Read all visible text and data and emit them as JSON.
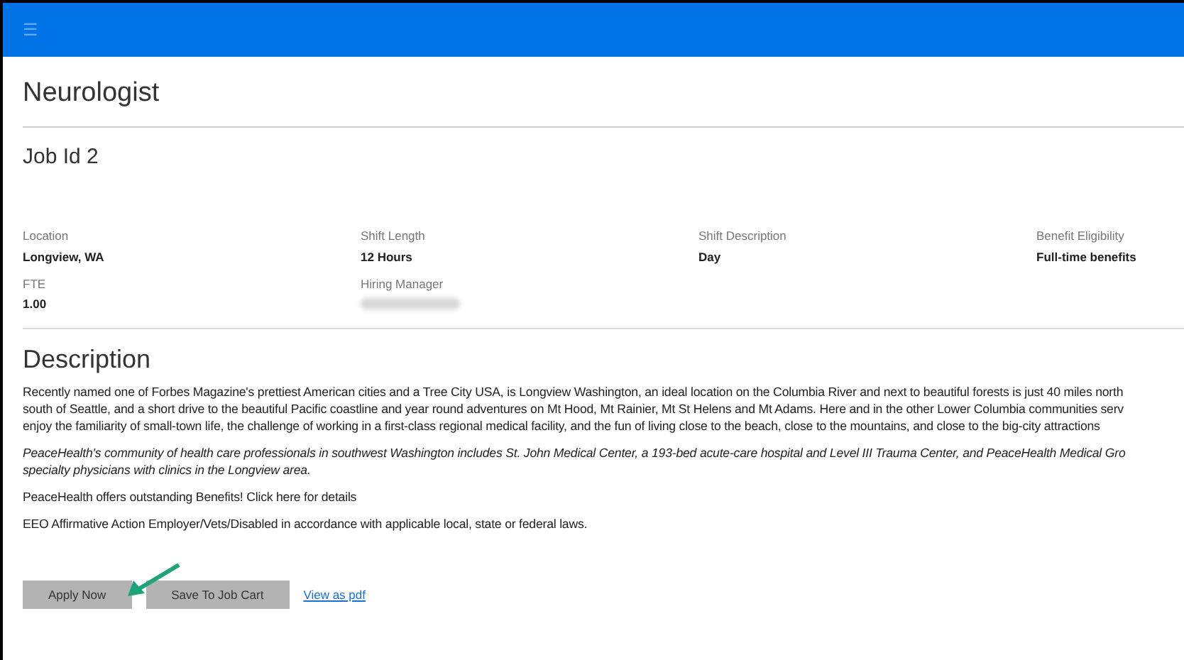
{
  "header": {
    "menu_icon": "☰"
  },
  "title": "Neurologist",
  "job_id": "Job Id 2",
  "fields": [
    {
      "label": "Location",
      "value": "Longview, WA"
    },
    {
      "label": "Shift Length",
      "value": "12 Hours"
    },
    {
      "label": "Shift Description",
      "value": "Day"
    },
    {
      "label": "Benefit Eligibility",
      "value": "Full-time benefits"
    },
    {
      "label": "FTE",
      "value": "1.00"
    },
    {
      "label": "Hiring Manager",
      "value_blurred": true
    }
  ],
  "description": {
    "heading": "Description",
    "paragraphs": [
      {
        "italic": false,
        "lines": [
          "Recently named one of Forbes Magazine's prettiest American cities and a Tree City USA, is Longview Washington, an ideal location on the Columbia River and next to beautiful forests is just 40 miles north",
          "south of Seattle, and a short drive to the beautiful Pacific coastline and year round adventures on Mt Hood, Mt Rainier, Mt St Helens and Mt Adams. Here and in the other Lower Columbia communities serv",
          "enjoy the familiarity of small-town life, the challenge of working in a first-class regional medical facility, and the fun of living close to the beach, close to the mountains, and close to the big-city attractions"
        ]
      },
      {
        "italic": true,
        "lines": [
          "PeaceHealth's community of health care professionals in southwest Washington includes St. John Medical Center, a 193-bed acute-care hospital and Level III Trauma Center, and PeaceHealth Medical Gro",
          "specialty physicians with clinics in the Longview area."
        ]
      },
      {
        "italic": false,
        "lines": [
          "PeaceHealth offers outstanding Benefits! Click here for details"
        ]
      },
      {
        "italic": false,
        "lines": [
          "EEO Affirmative Action Employer/Vets/Disabled in accordance with applicable local, state or federal laws."
        ]
      }
    ]
  },
  "actions": [
    {
      "kind": "button",
      "label": "Apply Now"
    },
    {
      "kind": "button",
      "label": "Save To Job Cart"
    },
    {
      "kind": "link",
      "label": "View as pdf"
    }
  ]
}
